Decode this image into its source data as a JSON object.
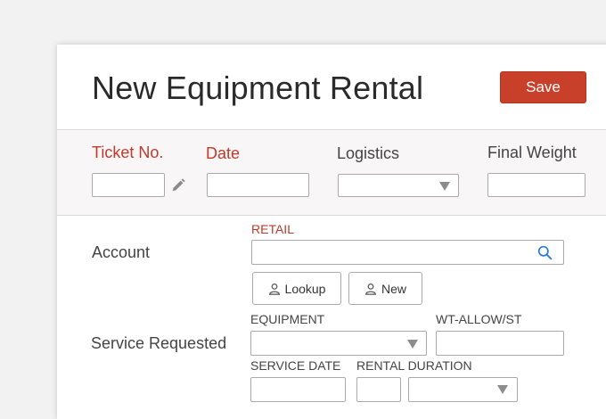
{
  "form": {
    "title": "New Equipment Rental",
    "save_label": "Save"
  },
  "header_fields": {
    "ticket_label": "Ticket No.",
    "date_label": "Date",
    "logistics_label": "Logistics",
    "final_weight_label": "Final Weight",
    "ticket_value": "",
    "date_value": "",
    "logistics_value": "",
    "final_weight_value": ""
  },
  "account": {
    "label": "Account",
    "sub_label": "RETAIL",
    "input_value": "",
    "lookup_label": "Lookup",
    "new_label": "New"
  },
  "service": {
    "label": "Service Requested",
    "equipment_label": "EQUIPMENT",
    "wt_label": "WT-ALLOW/ST",
    "service_date_label": "SERVICE DATE",
    "rental_duration_label": "RENTAL DURATION",
    "equipment_value": "",
    "wt_value": "",
    "service_date_value": "",
    "rental_duration_value": "",
    "rental_unit_value": ""
  },
  "colors": {
    "accent": "#c8402a",
    "required_label": "#c0392b"
  },
  "icons": [
    "pencil-icon",
    "search-icon",
    "person-icon",
    "dropdown-arrow-icon"
  ]
}
